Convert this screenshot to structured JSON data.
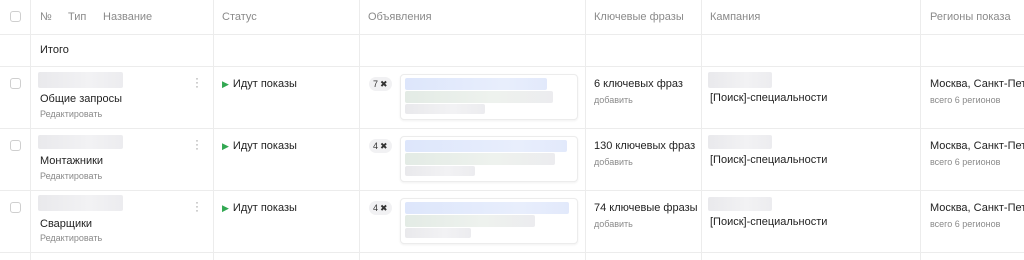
{
  "header": {
    "num": "№",
    "type": "Тип",
    "name": "Название",
    "status": "Статус",
    "ads": "Объявления",
    "keywords": "Ключевые фразы",
    "campaign": "Кампания",
    "regions": "Регионы показа"
  },
  "total_label": "Итого",
  "rows": [
    {
      "name": "Общие запросы",
      "edit": "Редактировать",
      "status": "Идут показы",
      "ads_count": "7",
      "keywords": "6 ключевых фраз",
      "add": "добавить",
      "campaign": "[Поиск]-специальности",
      "region": "Москва, Санкт-Пет",
      "region_more": "всего 6 регионов"
    },
    {
      "name": "Монтажники",
      "edit": "Редактировать",
      "status": "Идут показы",
      "ads_count": "4",
      "keywords": "130 ключевых фраз",
      "add": "добавить",
      "campaign": "[Поиск]-специальности",
      "region": "Москва, Санкт-Пет",
      "region_more": "всего 6 регионов"
    },
    {
      "name": "Сварщики",
      "edit": "Редактировать",
      "status": "Идут показы",
      "ads_count": "4",
      "keywords": "74 ключевые фразы",
      "add": "добавить",
      "campaign": "[Поиск]-специальности",
      "region": "Москва, Санкт-Пет",
      "region_more": "всего 6 регионов"
    }
  ],
  "colors": {
    "status_play": "#32a852",
    "border": "#ececec",
    "muted_text": "#8a8a8a"
  }
}
